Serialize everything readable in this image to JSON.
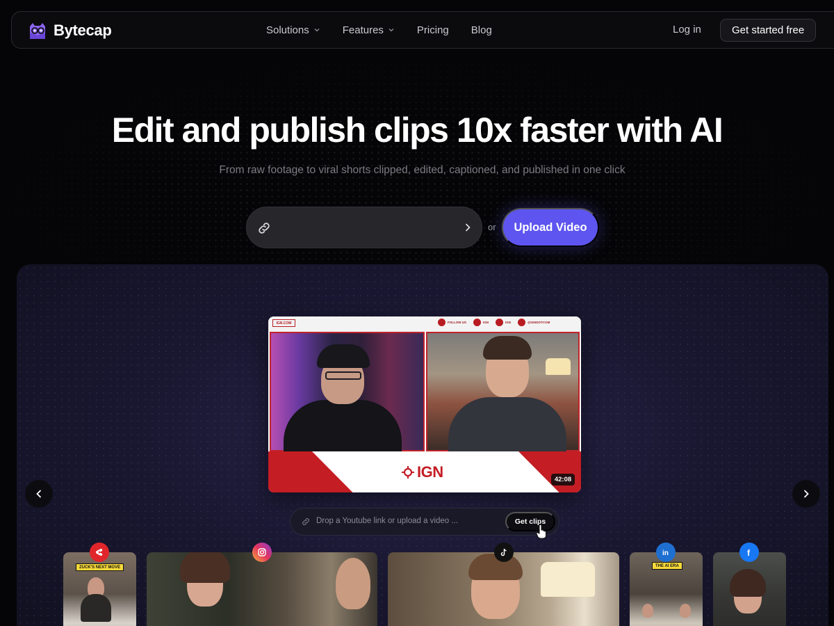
{
  "brand": {
    "name": "Bytecap",
    "accent": "#5e55f0"
  },
  "nav": {
    "links": [
      {
        "label": "Solutions",
        "has_dropdown": true
      },
      {
        "label": "Features",
        "has_dropdown": true
      },
      {
        "label": "Pricing",
        "has_dropdown": false
      },
      {
        "label": "Blog",
        "has_dropdown": false
      }
    ],
    "login_label": "Log in",
    "cta_label": "Get started free"
  },
  "hero": {
    "title": "Edit and publish clips 10x faster with AI",
    "subtitle": "From raw footage to viral shorts clipped, edited, captioned, and published in one click",
    "url_input": {
      "value": "",
      "placeholder": "",
      "icon": "link-icon",
      "submit_icon": "chevron-right-icon"
    },
    "or_label": "or",
    "upload_label": "Upload Video"
  },
  "demo": {
    "video": {
      "top_left_tag": "IGN.COM",
      "socials": [
        {
          "label": "FOLLOW US",
          "icon": "instagram-icon"
        },
        {
          "label": "IGN",
          "icon": "twitter-icon"
        },
        {
          "label": "IGN",
          "icon": "snapchat-icon"
        },
        {
          "label": "@IGNDOTCOM",
          "icon": "instagram-icon"
        }
      ],
      "logo_text": "IGN",
      "duration": "42:08"
    },
    "drop_bar": {
      "placeholder": "Drop a Youtube link or upload a video ...",
      "button_label": "Get clips"
    },
    "clips": [
      {
        "platform": "youtube-shorts",
        "badge_color": "#e0262b",
        "caption": "ZUCK'S NEXT MOVE"
      },
      {
        "platform": "instagram",
        "badge_color": "#d6336c",
        "caption": ""
      },
      {
        "platform": "tiktok",
        "badge_color": "#111111",
        "caption": ""
      },
      {
        "platform": "linkedin",
        "badge_color": "#1f6fd1",
        "caption": "THE AI ERA"
      },
      {
        "platform": "facebook",
        "badge_color": "#1877f2",
        "caption": ""
      }
    ]
  }
}
